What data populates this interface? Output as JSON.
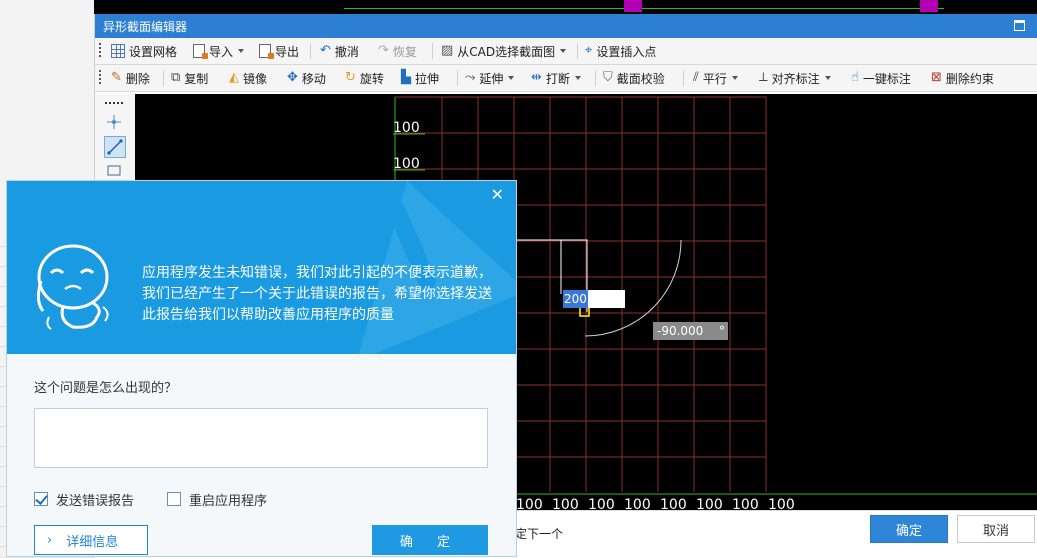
{
  "editor": {
    "title": "异形截面编辑器",
    "toolbar1": [
      {
        "label": "设置网格",
        "icon": "grid-icon",
        "enabled": true
      },
      {
        "label": "导入",
        "icon": "import-icon",
        "enabled": true,
        "dropdown": true
      },
      {
        "label": "导出",
        "icon": "export-icon",
        "enabled": true
      },
      {
        "label": "撤消",
        "icon": "undo-icon",
        "enabled": true
      },
      {
        "label": "恢复",
        "icon": "redo-icon",
        "enabled": false
      },
      {
        "label": "从CAD选择截面图",
        "icon": "cad-select-icon",
        "enabled": true,
        "dropdown": true
      },
      {
        "label": "设置插入点",
        "icon": "insert-point-icon",
        "enabled": true
      }
    ],
    "toolbar2": [
      {
        "label": "删除",
        "icon": "eraser-icon"
      },
      {
        "label": "复制",
        "icon": "copy-icon"
      },
      {
        "label": "镜像",
        "icon": "mirror-icon"
      },
      {
        "label": "移动",
        "icon": "move-icon"
      },
      {
        "label": "旋转",
        "icon": "rotate-icon"
      },
      {
        "label": "拉伸",
        "icon": "stretch-icon"
      },
      {
        "label": "延伸",
        "icon": "extend-icon",
        "dropdown": true
      },
      {
        "label": "打断",
        "icon": "break-icon",
        "dropdown": true
      },
      {
        "label": "截面校验",
        "icon": "check-shield-icon"
      },
      {
        "label": "平行",
        "icon": "parallel-icon",
        "dropdown": true
      },
      {
        "label": "对齐标注",
        "icon": "align-dimension-icon",
        "dropdown": true
      },
      {
        "label": "一键标注",
        "icon": "auto-dimension-icon"
      },
      {
        "label": "删除约束",
        "icon": "delete-constraint-icon"
      }
    ],
    "canvas": {
      "grid_spacing_label": "100",
      "left_dims": [
        "100",
        "100"
      ],
      "bottom_dims": [
        "100",
        "100",
        "100",
        "100",
        "100",
        "100",
        "100",
        "100"
      ],
      "length_input": "200",
      "angle_input": "-90.000",
      "angle_unit": "°",
      "colors": {
        "background": "#000000",
        "grid": "#8a3030",
        "dimension": "#2db82d",
        "cursor": "#ffff00"
      }
    },
    "status_text": "定下一个",
    "ok_label": "确定",
    "cancel_label": "取消"
  },
  "error_dialog": {
    "close_glyph": "✕",
    "message": "应用程序发生未知错误，我们对此引起的不便表示道歉，我们已经产生了一个关于此错误的报告，希望你选择发送此报告给我们以帮助改善应用程序的质量",
    "question": "这个问题是怎么出现的？",
    "description_value": "",
    "send_report_label": "发送错误报告",
    "send_report_checked": true,
    "restart_label": "重启应用程序",
    "restart_checked": false,
    "details_label": "详细信息",
    "ok_label": "确 定",
    "colors": {
      "header": "#1a9ae0",
      "accent": "#1f86d4"
    }
  }
}
